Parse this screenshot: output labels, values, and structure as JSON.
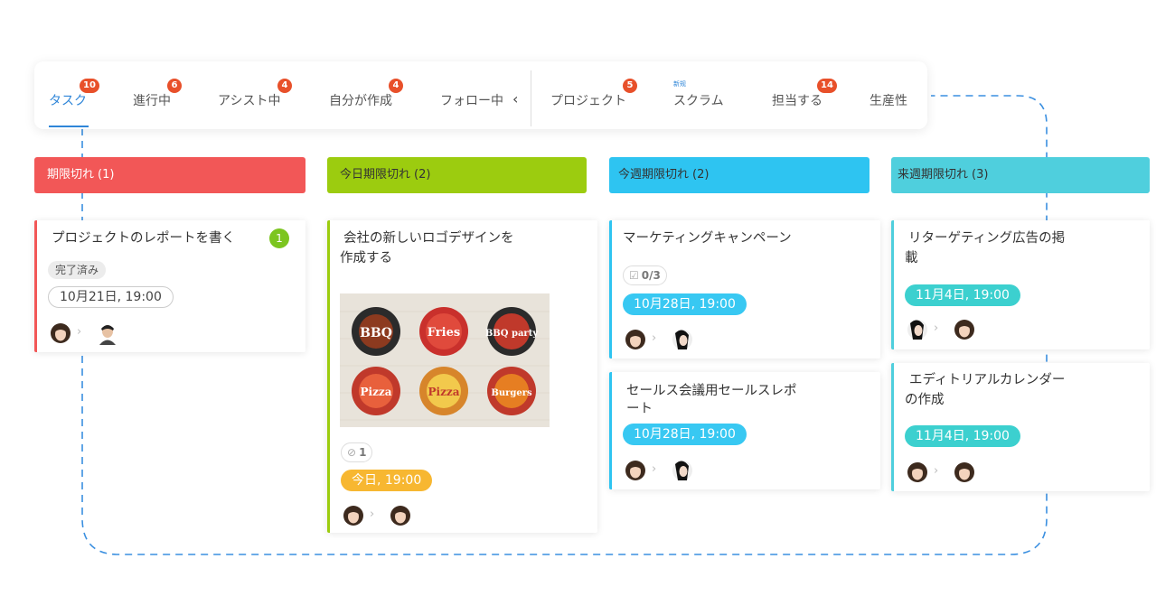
{
  "tabs": [
    {
      "label": "タスク",
      "badge": "10",
      "active": true
    },
    {
      "label": "進行中",
      "badge": "6"
    },
    {
      "label": "アシスト中",
      "badge": "4"
    },
    {
      "label": "自分が作成",
      "badge": "4"
    },
    {
      "label": "フォロー中"
    },
    {
      "label": "プロジェクト",
      "badge": "5"
    },
    {
      "label": "スクラム",
      "tag": "新规"
    },
    {
      "label": "担当する",
      "badge": "14"
    },
    {
      "label": "生産性"
    }
  ],
  "chevron": "‹",
  "columns": [
    {
      "title": "期限切れ",
      "count": "(1)",
      "color": "#f25757"
    },
    {
      "title": "今日期限切れ",
      "count": "(2)",
      "color": "#9ccc0f"
    },
    {
      "title": "今週期限切れ",
      "count": "(2)",
      "color": "#2ec4f1"
    },
    {
      "title": "来週期限切れ",
      "count": "(3)",
      "color": "#4fcfdd"
    }
  ],
  "cards": {
    "overdue": {
      "title": "プロジェクトのレポートを書く",
      "comment_count": "1",
      "status": "完了済み",
      "date": "10月21日, 19:00"
    },
    "today": {
      "title_line1": "会社の新しいロゴデザインを",
      "title_line2": "作成する",
      "attachments": "1",
      "date": "今日, 19:00",
      "image_labels": [
        "BBQ",
        "Fries",
        "BBQ party",
        "Pizza",
        "Pizza",
        "Burgers"
      ]
    },
    "marketing": {
      "title": "マーケティングキャンペーン",
      "checklist": "0/3",
      "date": "10月28日, 19:00"
    },
    "sales": {
      "title_line1": "セールス会議用セールスレポ",
      "title_line2": "ート",
      "date": "10月28日, 19:00"
    },
    "retargeting": {
      "title_line1": "リターゲティング広告の掲",
      "title_line2": "載",
      "date": "11月4日, 19:00"
    },
    "editorial": {
      "title_line1": "エディトリアルカレンダー",
      "title_line2": "の作成",
      "date": "11月4日, 19:00"
    }
  },
  "icons": {
    "arrow": "›",
    "attachment": "paperclip-icon",
    "checklist": "checkbox-icon"
  },
  "colors": {
    "accent": "#2f86d8",
    "badge": "#e8502a",
    "overdue": "#f25757",
    "today": "#9ccc0f",
    "week": "#2ec4f1",
    "nextweek": "#4fcfdd",
    "today_date": "#f7b731",
    "week_date": "#38c8f2",
    "nextweek_date": "#3cd0cf"
  }
}
